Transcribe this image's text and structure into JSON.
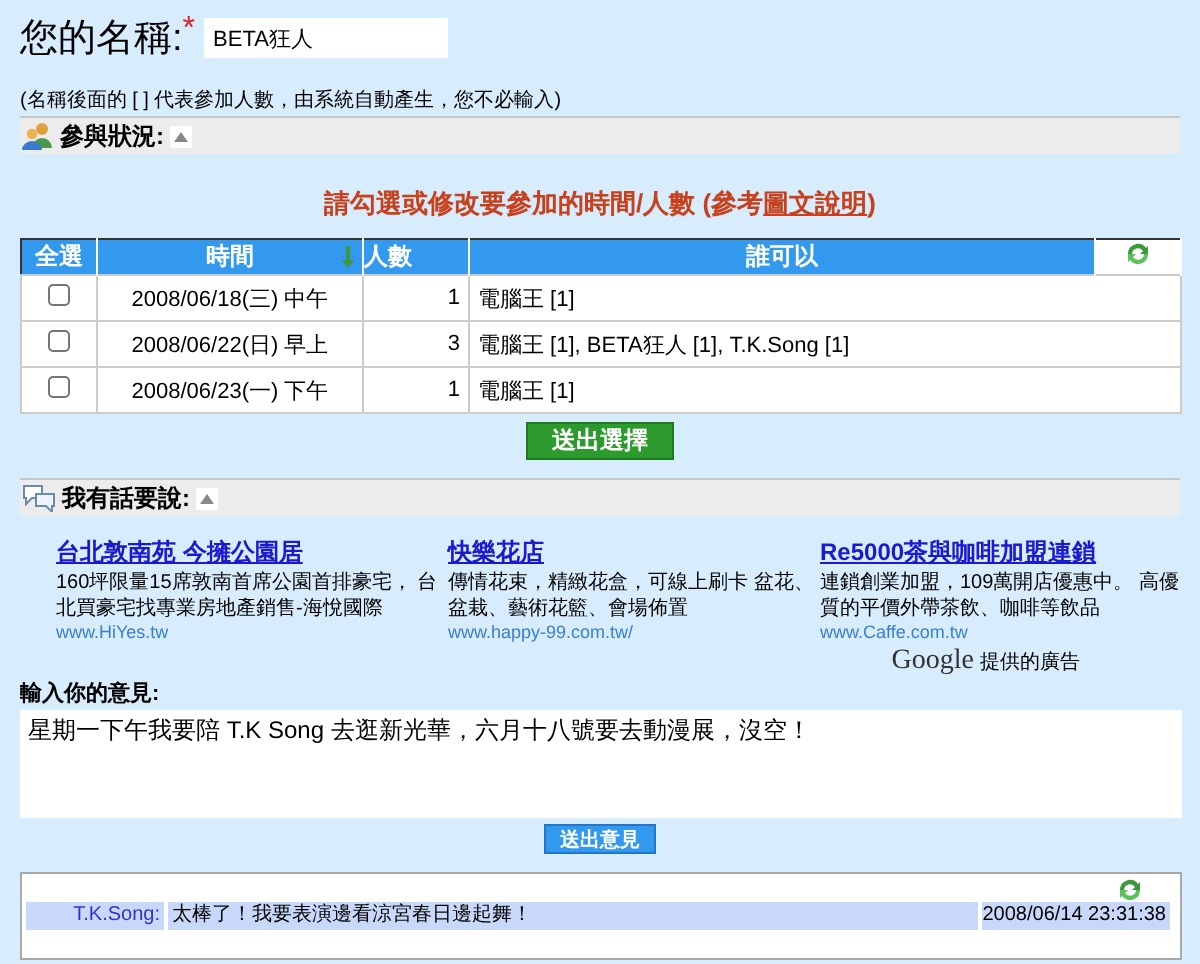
{
  "name_field": {
    "label": "您的名稱:",
    "required_mark": "*",
    "value": "BETA狂人"
  },
  "name_note": "(名稱後面的 [ ] 代表參加人數，由系統自動產生，您不必輸入)",
  "participation": {
    "title": "參與狀況:",
    "expanded": true,
    "instruction": {
      "before": "請勾選或修改要參加的時間/人數 (參考",
      "link": "圖文說明",
      "after": ")"
    },
    "table": {
      "columns": [
        "全選",
        "時間",
        "人數",
        "誰可以"
      ],
      "rows": [
        {
          "checked": false,
          "time": "2008/06/18(三) 中午",
          "count": "1",
          "who": "電腦王 [1]"
        },
        {
          "checked": false,
          "time": "2008/06/22(日) 早上",
          "count": "3",
          "who": "電腦王 [1], BETA狂人 [1], T.K.Song [1]"
        },
        {
          "checked": false,
          "time": "2008/06/23(一) 下午",
          "count": "1",
          "who": "電腦王 [1]"
        }
      ]
    },
    "submit_button": "送出選擇"
  },
  "comments_section": {
    "title": "我有話要說:",
    "expanded": true,
    "ads": [
      {
        "title": "台北敦南苑 今擁公園居",
        "body": "160坪限量15席敦南首席公園首排豪宅， 台北買豪宅找專業房地產銷售-海悅國際",
        "url": "www.HiYes.tw"
      },
      {
        "title": "快樂花店",
        "body": "傳情花束，精緻花盒，可線上刷卡 盆花、盆栽、藝術花籃、會場佈置",
        "url": "www.happy-99.com.tw/"
      },
      {
        "title": "Re5000茶與咖啡加盟連鎖",
        "body": "連鎖創業加盟，109萬開店優惠中。 高優質的平價外帶茶飲、咖啡等飲品",
        "url": "www.Caffe.com.tw"
      }
    ],
    "ads_credit": {
      "brand": "Google",
      "text": "提供的廣告"
    },
    "input_label": "輸入你的意見:",
    "input_value": "星期一下午我要陪 T.K Song 去逛新光華，六月十八號要去動漫展，沒空！",
    "submit_button": "送出意見",
    "messages": [
      {
        "author": "T.K.Song:",
        "text": "太棒了！我要表演邊看涼宮春日邊起舞！",
        "time": "2008/06/14 23:31:38"
      }
    ]
  }
}
